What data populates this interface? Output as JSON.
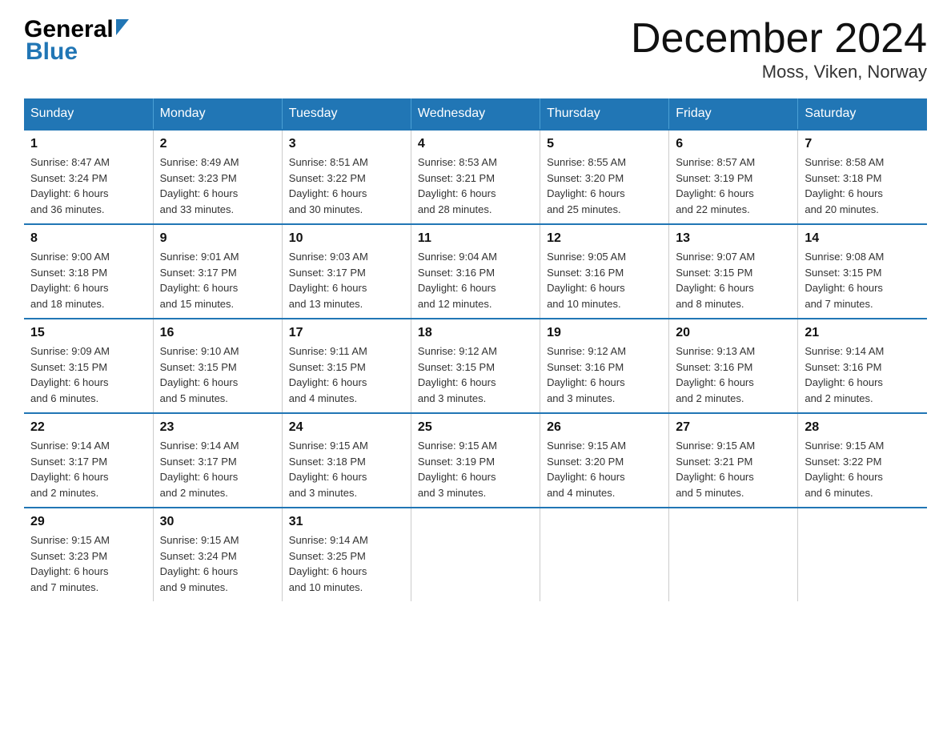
{
  "header": {
    "month_title": "December 2024",
    "location": "Moss, Viken, Norway"
  },
  "logo": {
    "line1": "General",
    "line2": "Blue"
  },
  "days_of_week": [
    "Sunday",
    "Monday",
    "Tuesday",
    "Wednesday",
    "Thursday",
    "Friday",
    "Saturday"
  ],
  "weeks": [
    [
      {
        "num": "1",
        "sunrise": "8:47 AM",
        "sunset": "3:24 PM",
        "daylight": "6 hours and 36 minutes."
      },
      {
        "num": "2",
        "sunrise": "8:49 AM",
        "sunset": "3:23 PM",
        "daylight": "6 hours and 33 minutes."
      },
      {
        "num": "3",
        "sunrise": "8:51 AM",
        "sunset": "3:22 PM",
        "daylight": "6 hours and 30 minutes."
      },
      {
        "num": "4",
        "sunrise": "8:53 AM",
        "sunset": "3:21 PM",
        "daylight": "6 hours and 28 minutes."
      },
      {
        "num": "5",
        "sunrise": "8:55 AM",
        "sunset": "3:20 PM",
        "daylight": "6 hours and 25 minutes."
      },
      {
        "num": "6",
        "sunrise": "8:57 AM",
        "sunset": "3:19 PM",
        "daylight": "6 hours and 22 minutes."
      },
      {
        "num": "7",
        "sunrise": "8:58 AM",
        "sunset": "3:18 PM",
        "daylight": "6 hours and 20 minutes."
      }
    ],
    [
      {
        "num": "8",
        "sunrise": "9:00 AM",
        "sunset": "3:18 PM",
        "daylight": "6 hours and 18 minutes."
      },
      {
        "num": "9",
        "sunrise": "9:01 AM",
        "sunset": "3:17 PM",
        "daylight": "6 hours and 15 minutes."
      },
      {
        "num": "10",
        "sunrise": "9:03 AM",
        "sunset": "3:17 PM",
        "daylight": "6 hours and 13 minutes."
      },
      {
        "num": "11",
        "sunrise": "9:04 AM",
        "sunset": "3:16 PM",
        "daylight": "6 hours and 12 minutes."
      },
      {
        "num": "12",
        "sunrise": "9:05 AM",
        "sunset": "3:16 PM",
        "daylight": "6 hours and 10 minutes."
      },
      {
        "num": "13",
        "sunrise": "9:07 AM",
        "sunset": "3:15 PM",
        "daylight": "6 hours and 8 minutes."
      },
      {
        "num": "14",
        "sunrise": "9:08 AM",
        "sunset": "3:15 PM",
        "daylight": "6 hours and 7 minutes."
      }
    ],
    [
      {
        "num": "15",
        "sunrise": "9:09 AM",
        "sunset": "3:15 PM",
        "daylight": "6 hours and 6 minutes."
      },
      {
        "num": "16",
        "sunrise": "9:10 AM",
        "sunset": "3:15 PM",
        "daylight": "6 hours and 5 minutes."
      },
      {
        "num": "17",
        "sunrise": "9:11 AM",
        "sunset": "3:15 PM",
        "daylight": "6 hours and 4 minutes."
      },
      {
        "num": "18",
        "sunrise": "9:12 AM",
        "sunset": "3:15 PM",
        "daylight": "6 hours and 3 minutes."
      },
      {
        "num": "19",
        "sunrise": "9:12 AM",
        "sunset": "3:16 PM",
        "daylight": "6 hours and 3 minutes."
      },
      {
        "num": "20",
        "sunrise": "9:13 AM",
        "sunset": "3:16 PM",
        "daylight": "6 hours and 2 minutes."
      },
      {
        "num": "21",
        "sunrise": "9:14 AM",
        "sunset": "3:16 PM",
        "daylight": "6 hours and 2 minutes."
      }
    ],
    [
      {
        "num": "22",
        "sunrise": "9:14 AM",
        "sunset": "3:17 PM",
        "daylight": "6 hours and 2 minutes."
      },
      {
        "num": "23",
        "sunrise": "9:14 AM",
        "sunset": "3:17 PM",
        "daylight": "6 hours and 2 minutes."
      },
      {
        "num": "24",
        "sunrise": "9:15 AM",
        "sunset": "3:18 PM",
        "daylight": "6 hours and 3 minutes."
      },
      {
        "num": "25",
        "sunrise": "9:15 AM",
        "sunset": "3:19 PM",
        "daylight": "6 hours and 3 minutes."
      },
      {
        "num": "26",
        "sunrise": "9:15 AM",
        "sunset": "3:20 PM",
        "daylight": "6 hours and 4 minutes."
      },
      {
        "num": "27",
        "sunrise": "9:15 AM",
        "sunset": "3:21 PM",
        "daylight": "6 hours and 5 minutes."
      },
      {
        "num": "28",
        "sunrise": "9:15 AM",
        "sunset": "3:22 PM",
        "daylight": "6 hours and 6 minutes."
      }
    ],
    [
      {
        "num": "29",
        "sunrise": "9:15 AM",
        "sunset": "3:23 PM",
        "daylight": "6 hours and 7 minutes."
      },
      {
        "num": "30",
        "sunrise": "9:15 AM",
        "sunset": "3:24 PM",
        "daylight": "6 hours and 9 minutes."
      },
      {
        "num": "31",
        "sunrise": "9:14 AM",
        "sunset": "3:25 PM",
        "daylight": "6 hours and 10 minutes."
      },
      null,
      null,
      null,
      null
    ]
  ],
  "labels": {
    "sunrise": "Sunrise:",
    "sunset": "Sunset:",
    "daylight": "Daylight:"
  }
}
